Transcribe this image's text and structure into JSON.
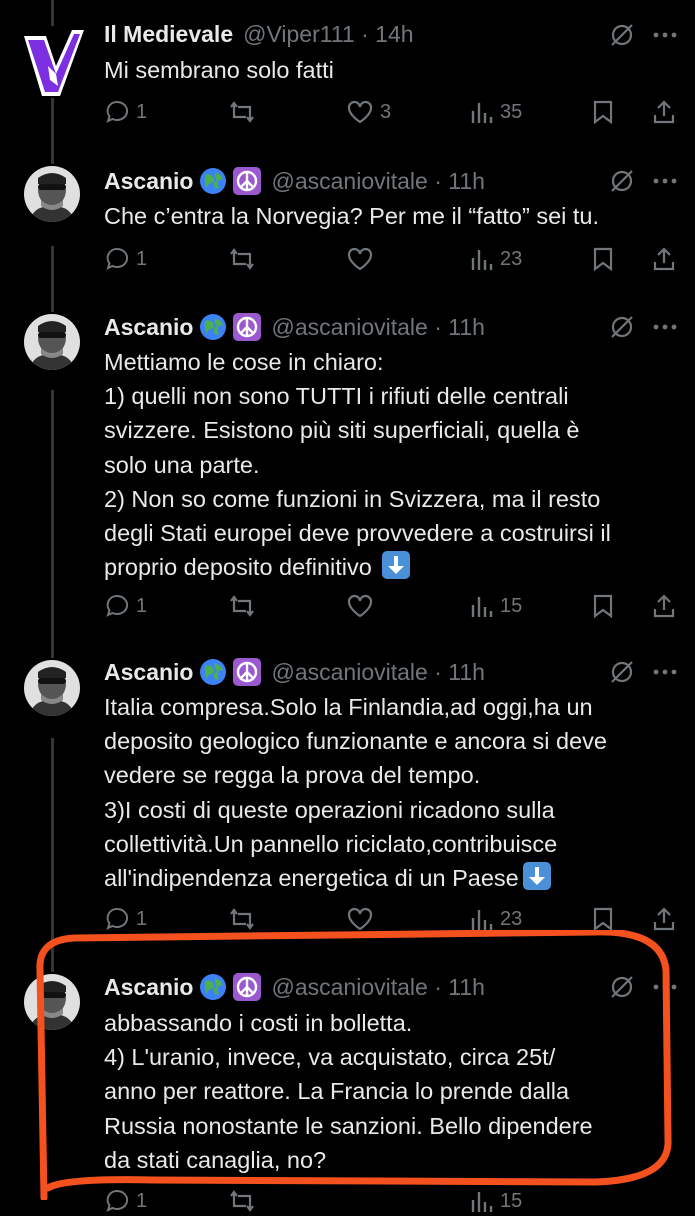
{
  "tweets": [
    {
      "name": "Il Medievale",
      "handle": "@Viper111 · 14h",
      "lines": [
        "Mi sembrano solo fatti"
      ],
      "replies": "1",
      "retweets": "",
      "likes": "3",
      "views": "35",
      "avatar_icon": "viper-logo-icon"
    },
    {
      "name": "Ascanio",
      "handle": "@ascaniovitale · 11h",
      "lines": [
        "Che c’entra la Norvegia? Per me il “fatto” sei tu."
      ],
      "replies": "1",
      "retweets": "",
      "likes": "",
      "views": "23",
      "avatar_icon": "profile-photo"
    },
    {
      "name": "Ascanio",
      "handle": "@ascaniovitale · 11h",
      "lines": [
        "Mettiamo le cose in chiaro:",
        "1) quelli non sono TUTTI i rifiuti delle centrali",
        "svizzere. Esistono più siti superficiali, quella è",
        "solo una parte.",
        "2) Non so come funzioni in Svizzera, ma il resto",
        "degli Stati europei deve provvedere a costruirsi il",
        "proprio deposito definitivo"
      ],
      "replies": "1",
      "retweets": "",
      "likes": "",
      "views": "15",
      "avatar_icon": "profile-photo"
    },
    {
      "name": "Ascanio",
      "handle": "@ascaniovitale · 11h",
      "lines": [
        "Italia compresa.Solo la Finlandia,ad oggi,ha un",
        "deposito geologico funzionante e ancora si deve",
        "vedere se regga la prova del tempo.",
        "3)I costi di queste operazioni ricadono sulla",
        "collettività.Un pannello riciclato,contribuisce",
        "all'indipendenza energetica di un Paese"
      ],
      "replies": "1",
      "retweets": "",
      "likes": "",
      "views": "23",
      "avatar_icon": "profile-photo"
    },
    {
      "name": "Ascanio",
      "handle": "@ascaniovitale · 11h",
      "lines": [
        "abbassando i costi in bolletta.",
        "4) L'uranio, invece, va acquistato, circa 25t/",
        "anno per reattore. La Francia lo prende dalla",
        "Russia nonostante le sanzioni. Bello dipendere",
        "da stati canaglia, no?"
      ],
      "replies": "1",
      "retweets": "",
      "likes": "",
      "views": "15",
      "avatar_icon": "profile-photo"
    }
  ],
  "colors": {
    "background": "#000000",
    "text": "#e7e9ea",
    "muted": "#71767b",
    "thread_line": "#333639",
    "highlight": "#f4511e"
  }
}
